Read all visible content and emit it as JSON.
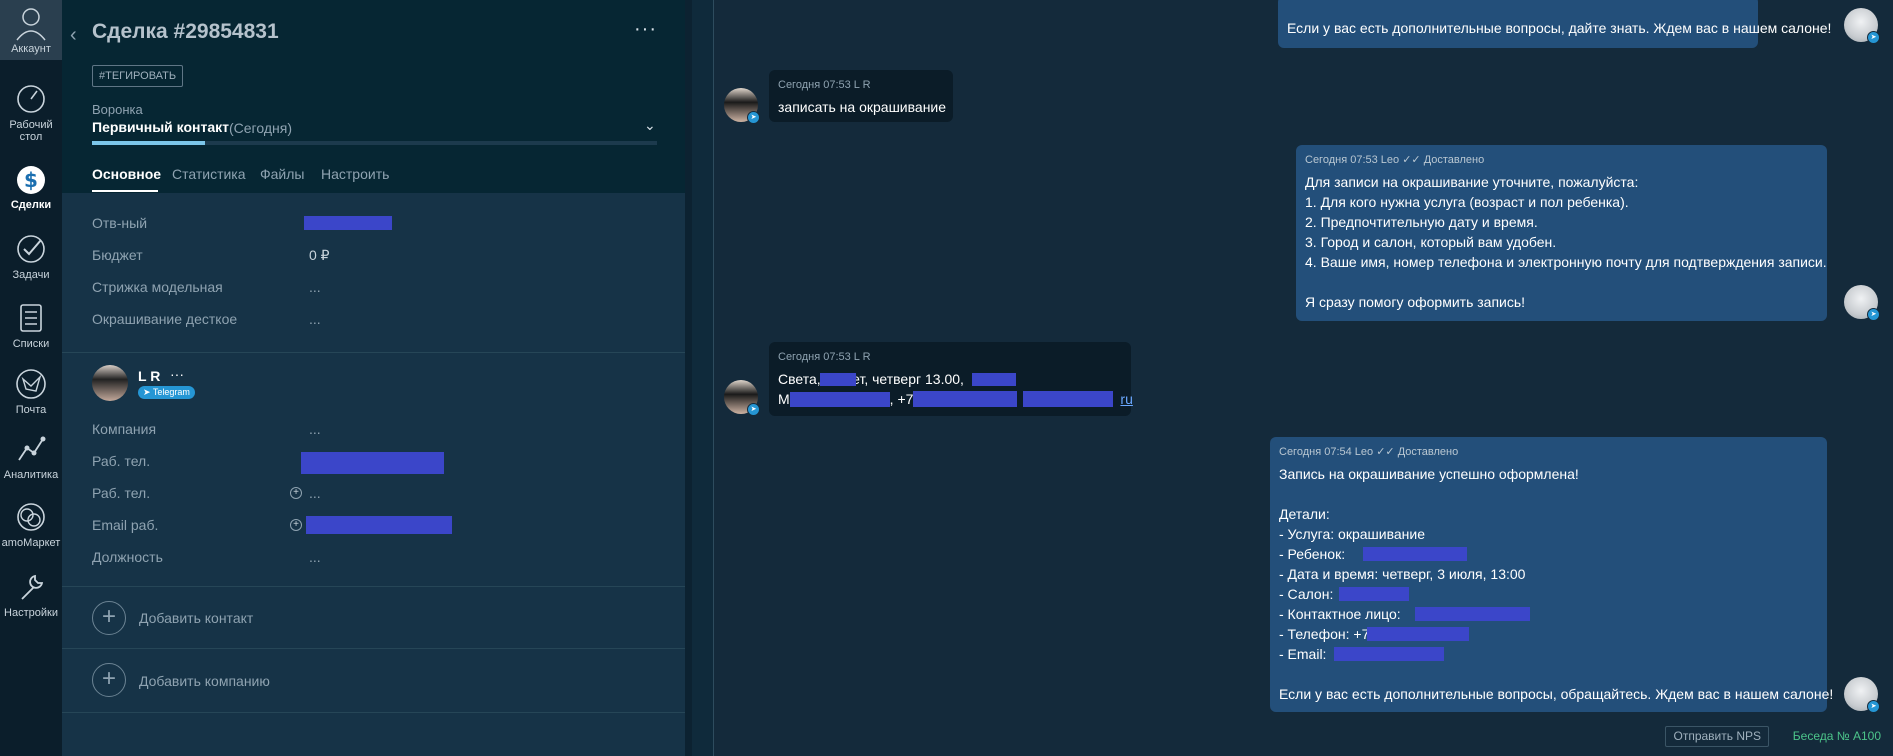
{
  "nav": {
    "account": "Аккаунт",
    "items": [
      {
        "label": "Рабочий стол"
      },
      {
        "label": "Сделки"
      },
      {
        "label": "Задачи"
      },
      {
        "label": "Списки"
      },
      {
        "label": "Почта"
      },
      {
        "label": "Аналитика"
      },
      {
        "label": "amoМаркет"
      },
      {
        "label": "Настройки"
      }
    ]
  },
  "lead": {
    "title": "Сделка #29854831",
    "tag_button": "#ТЕГИРОВАТЬ",
    "funnel_label": "Воронка",
    "funnel_value": "Первичный контакт",
    "funnel_date": "(Сегодня)",
    "stage_progress": 0.2,
    "tabs": [
      "Основное",
      "Статистика",
      "Файлы",
      "Настроить"
    ],
    "fields": {
      "responsible_label": "Отв-ный",
      "budget_label": "Бюджет",
      "budget_value": "0 ₽",
      "model_haircut_label": "Стрижка модельная",
      "model_haircut_value": "...",
      "kids_coloring_label": "Окрашивание десткое",
      "kids_coloring_value": "..."
    },
    "contact": {
      "name": "L R",
      "more": "···",
      "badge": "Telegram",
      "company_label": "Компания",
      "company_value": "...",
      "work_phone_label": "Раб. тел.",
      "work_phone2_label": "Раб. тел.",
      "work_phone2_value": "...",
      "email_label": "Email раб.",
      "position_label": "Должность",
      "position_value": "..."
    },
    "add_contact": "Добавить контакт",
    "add_company": "Добавить компанию"
  },
  "chat": {
    "messages": {
      "m0": {
        "line": "Если у вас есть дополнительные вопросы, дайте знать. Ждем вас в нашем салоне!"
      },
      "m1": {
        "meta": "Сегодня 07:53 L R",
        "line": "записать на окрашивание"
      },
      "m2": {
        "meta": "Сегодня 07:53 Leo ✓✓ Доставлено",
        "lines": [
          "Для записи на окрашивание уточните, пожалуйста:",
          "1. Для кого нужна услуга (возраст и пол ребенка).",
          "2. Предпочтительную дату и время.",
          "3. Город и салон, который вам удобен.",
          "4. Ваше имя, номер телефона и электронную почту для подтверждения записи.",
          "",
          "Я сразу помогу оформить запись!"
        ]
      },
      "m3": {
        "meta": "Сегодня 07:53 L R",
        "line1": "Света, 10 лет, четверг 13.00,",
        "line2_prefix": "М",
        "line2_mid": ", +7",
        "line2_suffix": "ru"
      },
      "m4": {
        "meta": "Сегодня 07:54 Leo ✓✓ Доставлено",
        "lines": [
          "Запись на окрашивание успешно оформлена!",
          "",
          "Детали:",
          "- Услуга: окрашивание",
          "- Ребенок:",
          "- Дата и время: четверг, 3 июля, 13:00",
          "- Салон:",
          "- Контактное лицо: ",
          "- Телефон: +7",
          "- Email:",
          "",
          "Если у вас есть дополнительные вопросы, обращайтесь. Ждем вас в нашем салоне!"
        ]
      }
    },
    "nps_button": "Отправить NPS",
    "conversation": "Беседа № А100"
  }
}
